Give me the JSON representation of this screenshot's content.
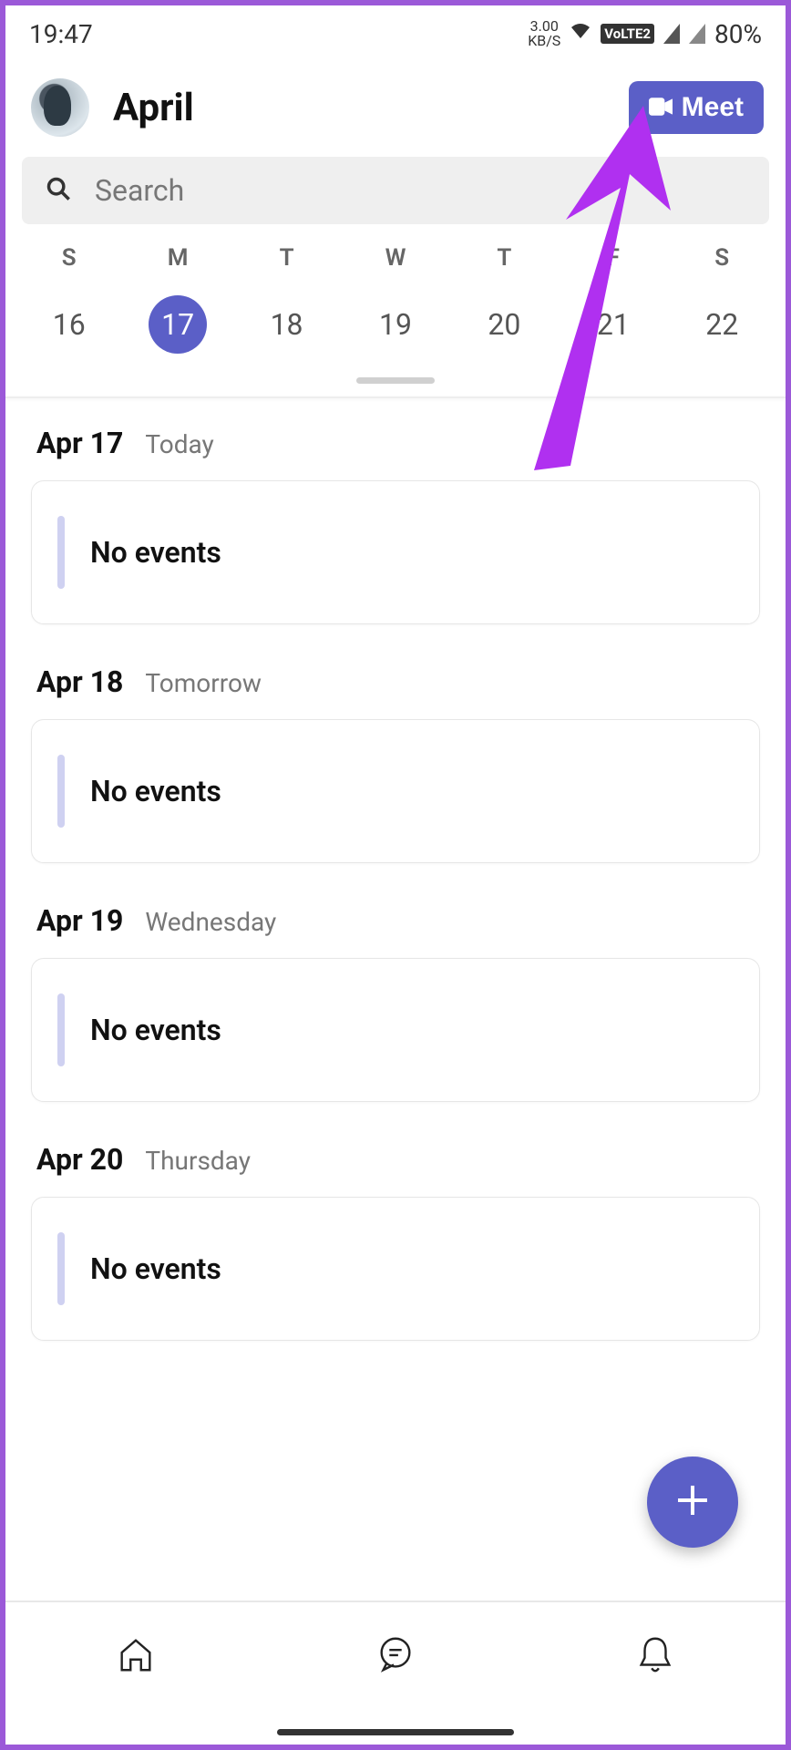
{
  "status": {
    "time": "19:47",
    "net_speed_top": "3.00",
    "net_speed_bottom": "KB/S",
    "lte_label": "VoLTE2",
    "battery": "80%"
  },
  "header": {
    "month": "April",
    "meet_label": "Meet"
  },
  "search": {
    "placeholder": "Search"
  },
  "week": {
    "dow": [
      "S",
      "M",
      "T",
      "W",
      "T",
      "F",
      "S"
    ],
    "dates": [
      "16",
      "17",
      "18",
      "19",
      "20",
      "21",
      "22"
    ],
    "selected_index": 1
  },
  "agenda": [
    {
      "date": "Apr 17",
      "rel": "Today",
      "event": "No events"
    },
    {
      "date": "Apr 18",
      "rel": "Tomorrow",
      "event": "No events"
    },
    {
      "date": "Apr 19",
      "rel": "Wednesday",
      "event": "No events"
    },
    {
      "date": "Apr 20",
      "rel": "Thursday",
      "event": "No events"
    }
  ],
  "annotation": {
    "color": "#b030f0"
  }
}
